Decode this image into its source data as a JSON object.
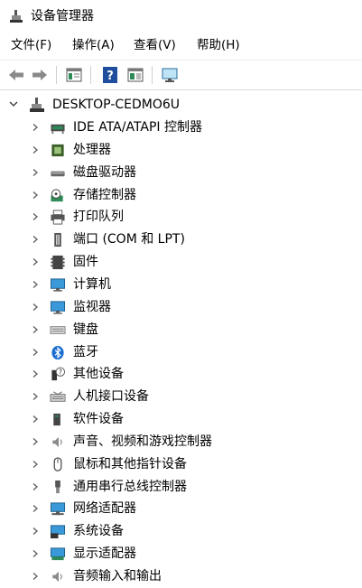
{
  "window": {
    "title": "设备管理器"
  },
  "menu": [
    {
      "label": "文件(F)"
    },
    {
      "label": "操作(A)"
    },
    {
      "label": "查看(V)"
    },
    {
      "label": "帮助(H)"
    }
  ],
  "toolbar": [
    {
      "icon": "back-arrow-icon"
    },
    {
      "icon": "forward-arrow-icon"
    },
    {
      "icon": "properties-icon"
    },
    {
      "icon": "help-icon"
    },
    {
      "icon": "show-hide-pane-icon"
    },
    {
      "icon": "scan-hardware-icon"
    }
  ],
  "tree": {
    "root": {
      "label": "DESKTOP-CEDMO6U",
      "icon": "computer-icon"
    },
    "categories": [
      {
        "label": "IDE ATA/ATAPI 控制器",
        "icon": "ide-controller-icon"
      },
      {
        "label": "处理器",
        "icon": "processor-icon"
      },
      {
        "label": "磁盘驱动器",
        "icon": "disk-drive-icon"
      },
      {
        "label": "存储控制器",
        "icon": "storage-controller-icon"
      },
      {
        "label": "打印队列",
        "icon": "printer-icon"
      },
      {
        "label": "端口 (COM 和 LPT)",
        "icon": "port-icon"
      },
      {
        "label": "固件",
        "icon": "firmware-icon"
      },
      {
        "label": "计算机",
        "icon": "monitor-icon"
      },
      {
        "label": "监视器",
        "icon": "monitor-icon"
      },
      {
        "label": "键盘",
        "icon": "keyboard-icon"
      },
      {
        "label": "蓝牙",
        "icon": "bluetooth-icon"
      },
      {
        "label": "其他设备",
        "icon": "unknown-device-icon"
      },
      {
        "label": "人机接口设备",
        "icon": "hid-icon"
      },
      {
        "label": "软件设备",
        "icon": "software-device-icon"
      },
      {
        "label": "声音、视频和游戏控制器",
        "icon": "speaker-icon"
      },
      {
        "label": "鼠标和其他指针设备",
        "icon": "mouse-icon"
      },
      {
        "label": "通用串行总线控制器",
        "icon": "usb-icon"
      },
      {
        "label": "网络适配器",
        "icon": "network-adapter-icon"
      },
      {
        "label": "系统设备",
        "icon": "system-device-icon"
      },
      {
        "label": "显示适配器",
        "icon": "display-adapter-icon"
      },
      {
        "label": "音频输入和输出",
        "icon": "audio-io-icon"
      }
    ]
  }
}
